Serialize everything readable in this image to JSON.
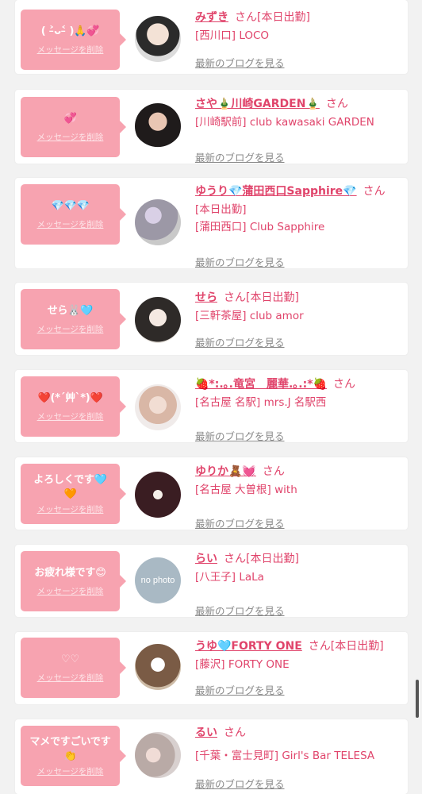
{
  "cards": [
    {
      "message": "( ˃̵ᴗ˂̵ )🙏💞",
      "delete_label": "メッセージを削除",
      "name": "みずき",
      "honorific": "さん",
      "status": "[本日出勤]",
      "shop": "[西川口] LOCO",
      "shop2": "",
      "blog_label": "最新のブログを見る"
    },
    {
      "message": "💞",
      "delete_label": "メッセージを削除",
      "name": "さや🎍川崎GARDEN🎍",
      "honorific": "さん",
      "status": "",
      "shop": "[川崎駅前] club kawasaki GARDEN",
      "shop2": "",
      "blog_label": "最新のブログを見る"
    },
    {
      "message": "💎💎💎",
      "delete_label": "メッセージを削除",
      "name": "ゆうり💎蒲田西口Sapphire💎",
      "honorific": "さん",
      "status": "",
      "shop": "[本日出勤]",
      "shop2": "[蒲田西口] Club Sapphire",
      "blog_label": "最新のブログを見る"
    },
    {
      "message": "せら🐰🩵",
      "delete_label": "メッセージを削除",
      "name": "せら",
      "honorific": "さん",
      "status": "[本日出勤]",
      "shop": "[三軒茶屋] club amor",
      "shop2": "",
      "blog_label": "最新のブログを見る"
    },
    {
      "message": "❤️(*´艸`*)❤️",
      "delete_label": "メッセージを削除",
      "name": "🍓*:.｡.竜宮　麗華.｡.:*🍓",
      "honorific": "さん",
      "status": "",
      "shop": "[名古屋 名駅] mrs.J 名駅西",
      "shop2": "",
      "blog_label": "最新のブログを見る"
    },
    {
      "message": "よろしくです🩵\n🧡",
      "delete_label": "メッセージを削除",
      "name": "ゆりか🧸💓",
      "honorific": "さん",
      "status": "",
      "shop": "[名古屋 大曽根] with",
      "shop2": "",
      "blog_label": "最新のブログを見る"
    },
    {
      "message": "お疲れ様です😊",
      "delete_label": "メッセージを削除",
      "name": "らい",
      "honorific": "さん",
      "status": "[本日出勤]",
      "shop": "[八王子] LaLa",
      "shop2": "",
      "blog_label": "最新のブログを見る"
    },
    {
      "message": "♡♡",
      "delete_label": "メッセージを削除",
      "name": "うゆ🩵FORTY ONE",
      "honorific": "さん",
      "status": "[本日出勤]",
      "shop": "[藤沢] FORTY ONE",
      "shop2": "",
      "blog_label": "最新のブログを見る"
    },
    {
      "message": "マメですごいです\n👏",
      "delete_label": "メッセージを削除",
      "name": "るい",
      "honorific": "さん",
      "status": "",
      "shop": "[千葉・富士見町] Girl's Bar TELESA",
      "shop2": "",
      "blog_label": "最新のブログを見る"
    }
  ],
  "placeholder_avatar_text": "no photo"
}
